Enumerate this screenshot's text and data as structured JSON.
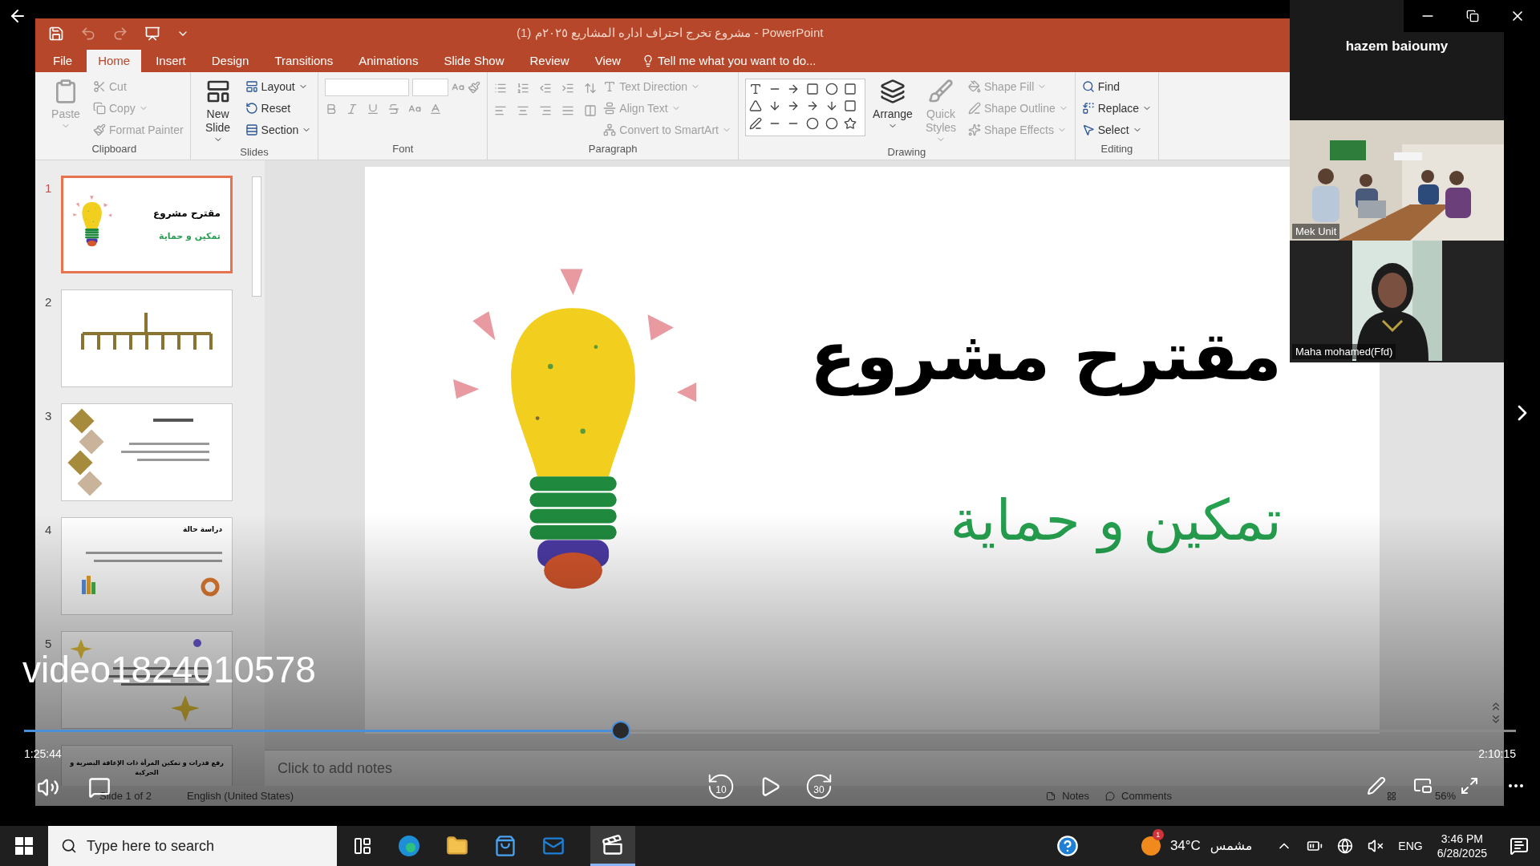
{
  "player": {
    "title": "video1824010578",
    "elapsed": "1:25:44",
    "duration": "2:10:15",
    "progress": {
      "level": 0.4
    },
    "skip_back": "10",
    "skip_forward": "30"
  },
  "powerpoint": {
    "title": "مشروع تخرج احتراف اداره المشاريع ٢٠٢٥م (1) - PowerPoint",
    "tabs": [
      {
        "label": "File",
        "selected": false
      },
      {
        "label": "Home",
        "selected": true
      },
      {
        "label": "Insert",
        "selected": false
      },
      {
        "label": "Design",
        "selected": false
      },
      {
        "label": "Transitions",
        "selected": false
      },
      {
        "label": "Animations",
        "selected": false
      },
      {
        "label": "Slide Show",
        "selected": false
      },
      {
        "label": "Review",
        "selected": false
      },
      {
        "label": "View",
        "selected": false
      }
    ],
    "tell_me": "Tell me what you want to do...",
    "ribbon_groups": [
      {
        "label": "Clipboard",
        "kind": "plain",
        "buttons": [
          {
            "label": "Paste",
            "kind": "large",
            "disabled": true,
            "menu": true
          },
          {
            "label": "Cut",
            "kind": "small",
            "disabled": true,
            "menu": false
          },
          {
            "label": "Copy",
            "kind": "small",
            "disabled": true,
            "menu": true
          },
          {
            "label": "Format Painter",
            "kind": "small",
            "disabled": true,
            "menu": false
          }
        ]
      },
      {
        "label": "Slides",
        "kind": "plain",
        "buttons": [
          {
            "label": "New Slide",
            "kind": "large",
            "disabled": false,
            "menu": true
          },
          {
            "label": "Layout",
            "kind": "small",
            "disabled": false,
            "menu": true
          },
          {
            "label": "Reset",
            "kind": "small",
            "disabled": false,
            "menu": false
          },
          {
            "label": "Section",
            "kind": "small",
            "disabled": false,
            "menu": true
          }
        ]
      },
      {
        "label": "Font",
        "kind": "font"
      },
      {
        "label": "Paragraph",
        "kind": "paragraph",
        "buttons": [
          {
            "label": "Text Direction",
            "kind": "small",
            "disabled": true,
            "menu": true
          },
          {
            "label": "Align Text",
            "kind": "small",
            "disabled": true,
            "menu": true
          },
          {
            "label": "Convert to SmartArt",
            "kind": "small",
            "disabled": true,
            "menu": true
          }
        ]
      },
      {
        "label": "Drawing",
        "kind": "shapes",
        "buttons": [
          {
            "label": "Arrange",
            "kind": "large",
            "disabled": false,
            "menu": true
          },
          {
            "label": "Quick Styles",
            "kind": "large",
            "disabled": true,
            "menu": true
          },
          {
            "label": "Shape Fill",
            "kind": "small",
            "disabled": true,
            "menu": true
          },
          {
            "label": "Shape Outline",
            "kind": "small",
            "disabled": true,
            "menu": true
          },
          {
            "label": "Shape Effects",
            "kind": "small",
            "disabled": true,
            "menu": true
          }
        ]
      },
      {
        "label": "Editing",
        "kind": "plain",
        "buttons": [
          {
            "label": "Find",
            "kind": "small",
            "disabled": false,
            "menu": false
          },
          {
            "label": "Replace",
            "kind": "small",
            "disabled": false,
            "menu": true
          },
          {
            "label": "Select",
            "kind": "small",
            "disabled": false,
            "menu": true
          }
        ]
      }
    ],
    "thumbnails": [
      {
        "number": "1",
        "selected": true,
        "kind": "title",
        "title": "مقترح مشروع",
        "subtitle": "تمكين و حماية"
      },
      {
        "number": "2",
        "selected": false,
        "kind": "tree"
      },
      {
        "number": "3",
        "selected": false,
        "kind": "diamonds"
      },
      {
        "number": "4",
        "selected": false,
        "kind": "case",
        "title": "دراسة حالة"
      },
      {
        "number": "5",
        "selected": false,
        "kind": "stars"
      },
      {
        "selected": false,
        "kind": "heading",
        "title": "رفع قدرات و تمكين المرأة ذات الإعاقة البصرية و الحركية"
      }
    ],
    "slide": {
      "title": "مقترح مشروع",
      "subtitle": "تمكين و حماية"
    },
    "notes_placeholder": "Click to add notes",
    "status_bar": {
      "slide_info": "Slide 1 of 2",
      "language": "English (United States)",
      "notes": "Notes",
      "comments": "Comments",
      "zoom": "56%"
    }
  },
  "meeting": {
    "host": "hazem baioumy",
    "participants": [
      {
        "name": "Mek Unit"
      },
      {
        "name": "Maha mohamed(Ffd)"
      }
    ]
  },
  "taskbar": {
    "search_placeholder": "Type here to search",
    "weather_badge": "1",
    "temperature": "34°C",
    "weather": "مشمس",
    "language": "ENG",
    "time": "3:46 PM",
    "date": "6/28/2025"
  }
}
